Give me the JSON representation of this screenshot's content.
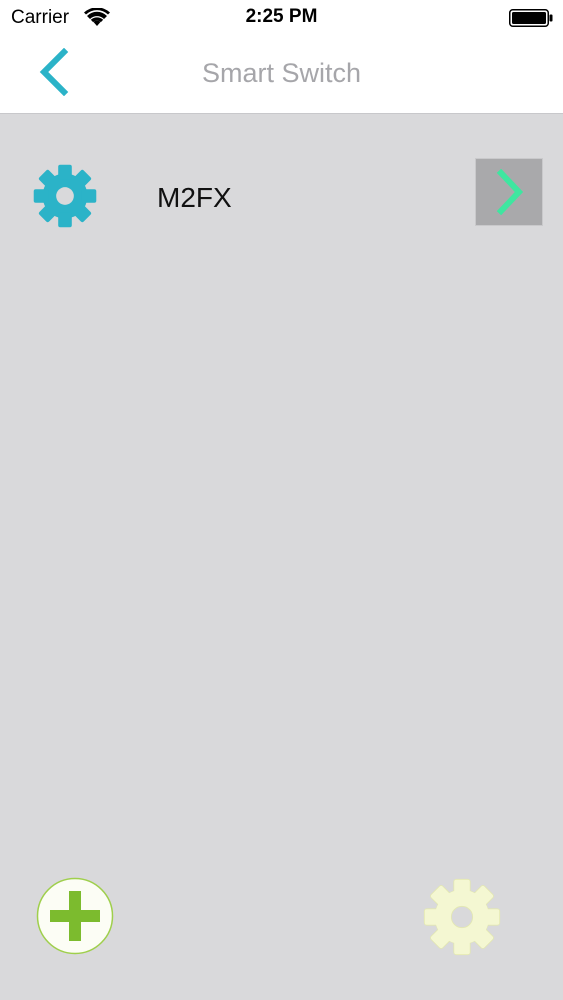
{
  "status_bar": {
    "carrier": "Carrier",
    "time": "2:25 PM",
    "wifi_icon": "wifi-icon",
    "battery_icon": "battery-icon"
  },
  "nav_bar": {
    "title": "Smart Switch",
    "back_icon": "chevron-left-icon"
  },
  "devices": [
    {
      "name": "M2FX",
      "icon": "gear-icon",
      "action_icon": "chevron-right-icon"
    }
  ],
  "toolbar": {
    "add_icon": "plus-icon",
    "settings_icon": "gear-icon"
  },
  "colors": {
    "accent_teal": "#2bb3c8",
    "chevron_green": "#3ee6a0",
    "add_green": "#7cbb2e",
    "settings_yellow": "#f4f7d2",
    "background": "#d9d9db",
    "title_gray": "#a6a6aa"
  }
}
